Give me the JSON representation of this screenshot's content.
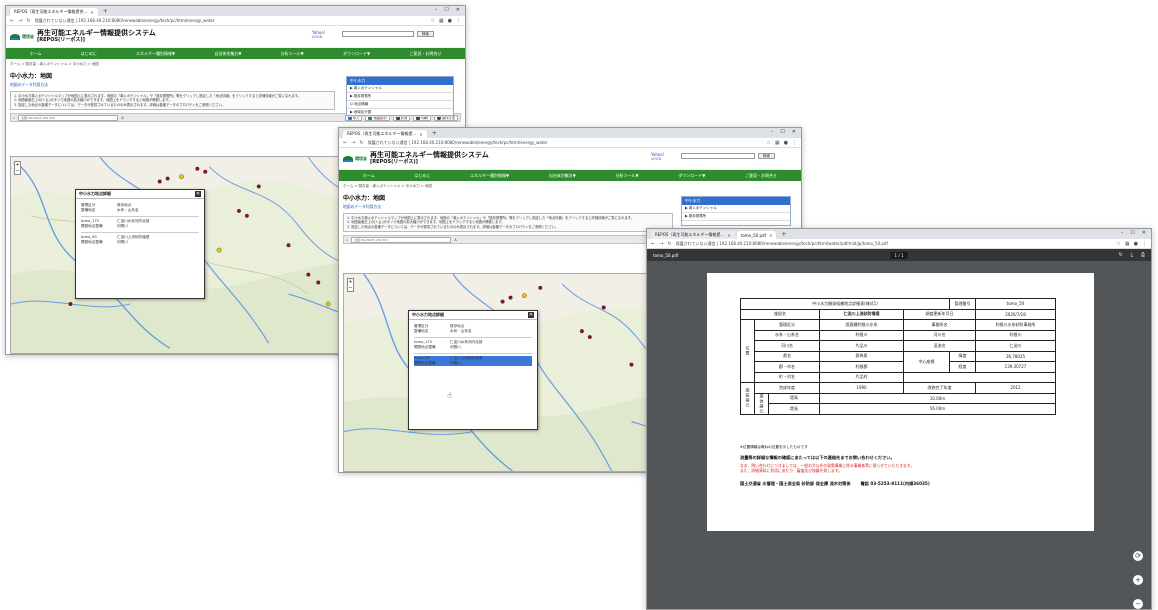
{
  "windows": {
    "back": {
      "tab_title": "REPOS（再生可能エネルギー情報提供…",
      "url": "保護されていない通信 | 192.168.40.210:8080/renewable/energy/tech/pc/html/energy_water"
    },
    "middle": {
      "tab_title": "REPOS（再生可能エネルギー情報提…",
      "url": "保護されていない通信 | 192.168.40.210:8080/renewable/energy/tech/pc/html/energy_water"
    },
    "front": {
      "tabs": [
        "REPOS（再生可能エネルギー情報提…",
        "tomo_50.pdf"
      ],
      "url": "保護されていない通信 | 192.168.40.210:8080/renewable/energy/tech/pc/html/water/pdf/mid/jp/tomo_50.pdf",
      "pdf_name": "tomo_50.pdf",
      "page_indicator": "1 / 1"
    }
  },
  "site": {
    "ministry": "環境省",
    "title": "再生可能エネルギー情報提供システム",
    "subtitle": "[REPOS(リーポス)]",
    "yahoo": "Yahoo!",
    "yahoo_jp": "JAPAN",
    "search_button": "検索",
    "nav": [
      "ホーム",
      "はじめに",
      "エネルギー種別情報▼",
      "自治体別集計▼",
      "分析ツール▼",
      "ダウンロード▼",
      "ご意見・お問合せ"
    ],
    "breadcrumb": "ホーム > 賦存量・導入ポテンシャル > 中小水力 > 地図",
    "page_heading": "中小水力：地図",
    "sub_link": "地図のデータ利用方法",
    "notes": [
      "1. 中小水力導入ポテンシャルマップが地図上に表示されます。地図の「導入ポテンシャル」や「既存発電所」等をクリックし指定した「地点情報」をクリックすると詳細情報がご覧になれます。",
      "2. 地図画面左上の[+][-]ボタンで地図の拡大縮小ができます。地図上をドラッグすると地図が移動します。",
      "3. 指定した地点の各種データについては、データが提供されているもののみ表示されます。詳細は各種データのプロパティをご参照ください。"
    ],
    "side_panel": {
      "header": "中小水力",
      "items": [
        "▶ 導入ポテンシャル",
        "▶ 既存発電所",
        "☑ 地点情報",
        "▶ 地域区分図"
      ]
    },
    "toolbar": {
      "coord": "北緯:36.209 E:139.333",
      "buttons": [
        "水力",
        "地図表示",
        "計測",
        "印刷",
        "操作方法"
      ]
    }
  },
  "popup": {
    "title": "中小水力地点詳細",
    "close": "✕",
    "rows": [
      {
        "k": "管理区分",
        "v": "既存地点"
      },
      {
        "k": "整備地名",
        "v": "水系・山系名"
      }
    ],
    "entries": [
      {
        "k": "tomo_170",
        "v": "仁淀川水系河内北部"
      },
      {
        "k": "開発地点整備",
        "v": "利根川"
      },
      {
        "k": "tomo_50",
        "v": "仁淀川上流砂防堰堤"
      },
      {
        "k": "開発地点整備",
        "v": "利根川"
      }
    ]
  },
  "pdf": {
    "title": "中小水力開発候補地点詳細表(様式1)",
    "id_label": "管理番号",
    "id_value": "tomo_50",
    "name_label": "施設名",
    "name_value": "仁淀川上流砂防堰堤",
    "updated_label": "調査更新年月日",
    "updated_value": "2020/7/18",
    "region_label": "位置",
    "rows": [
      {
        "l1": "管理区分",
        "v1": "国直轄利根川水系",
        "l2": "事務所名",
        "v2": "利根川水系砂防事務所"
      },
      {
        "l1": "水系・山系名",
        "v1": "利根川",
        "l2": "河川名",
        "v2": "利根川"
      },
      {
        "l1": "河川名",
        "v1": "片品川",
        "l2": "渓流名",
        "v2": "仁淀川"
      },
      {
        "l1": "県名",
        "v1": "群馬県",
        "l2": "緯度",
        "v2": "36.78025"
      },
      {
        "l1": "郡・市名",
        "v1": "利根郡",
        "l2": "経度",
        "v2": "139.30727"
      },
      {
        "l1": "町・村名",
        "v1": "片品村",
        "l2": "",
        "v2": ""
      }
    ],
    "coord_label": "中心座標",
    "built_label": "完成年度",
    "built_value": "1990",
    "repair_label": "改修完了年度",
    "repair_value": "2012",
    "spec_label": "施設諸元",
    "dam_label": "堤体諸元",
    "height_label": "堤高",
    "height_value": "10.00m",
    "length_label": "堤長",
    "length_value": "56.00m",
    "footnote": "※位置情報は概ねの位置を示したものです",
    "warning": "流量等の詳細な情報の確認にあたっては以下の連絡先までお問い合わせください。",
    "red_lines": [
      "なお、問い合わせにつきましては、一般の方以外の発電事業に係る事業者等に限らせていただきます。",
      "また、詳細資料に利用にあたり、審査及び協議を致します。"
    ],
    "contact_org": "国土交通省 水管理・国土保全局 砂防部 保全課 流木対策係",
    "contact_tel": "電話 03-5253-8111(内線36035)",
    "side_buttons": [
      "⟳",
      "+",
      "−"
    ]
  },
  "colors": {
    "nav_green": "#2e8b2e",
    "accent_blue": "#2f6fcf",
    "pdf_bg": "#525659",
    "warning_red": "#d81b1b"
  }
}
